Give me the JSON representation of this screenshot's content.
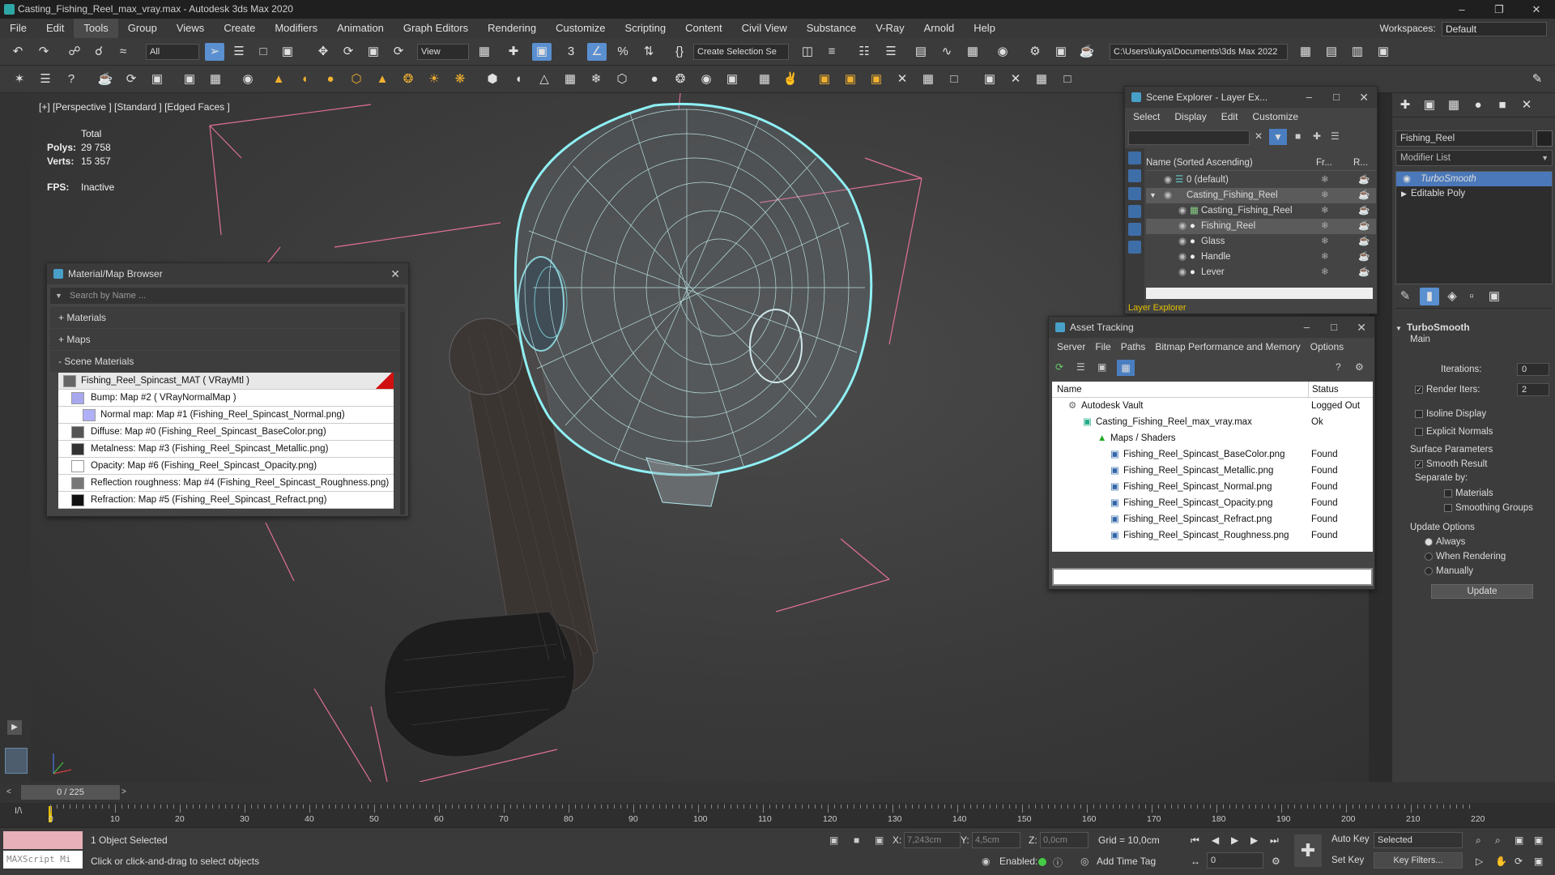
{
  "title": "Casting_Fishing_Reel_max_vray.max - Autodesk 3ds Max 2020",
  "menu": [
    "File",
    "Edit",
    "Tools",
    "Group",
    "Views",
    "Create",
    "Modifiers",
    "Animation",
    "Graph Editors",
    "Rendering",
    "Customize",
    "Scripting",
    "Content",
    "Civil View",
    "Substance",
    "V-Ray",
    "Arnold",
    "Help"
  ],
  "workspace": {
    "label": "Workspaces:",
    "value": "Default"
  },
  "toolbar": {
    "filter": "All",
    "refcoord": "View",
    "selection_set": "Create Selection Se",
    "project_path": "C:\\Users\\lukya\\Documents\\3ds Max 2022"
  },
  "viewport": {
    "label": "[+] [Perspective ] [Standard ] [Edged Faces ]",
    "stats_header": "Total",
    "polys_label": "Polys:",
    "polys": "29 758",
    "verts_label": "Verts:",
    "verts": "15 357",
    "fps_label": "FPS:",
    "fps": "Inactive"
  },
  "material_browser": {
    "title": "Material/Map Browser",
    "search_placeholder": "Search by Name ...",
    "sections": [
      "+ Materials",
      "+ Maps",
      "- Scene Materials"
    ],
    "material": "Fishing_Reel_Spincast_MAT  ( VRayMtl )",
    "maps": [
      "Bump: Map #2  ( VRayNormalMap )",
      "Normal map: Map #1 (Fishing_Reel_Spincast_Normal.png)",
      "Diffuse: Map #0 (Fishing_Reel_Spincast_BaseColor.png)",
      "Metalness: Map #3 (Fishing_Reel_Spincast_Metallic.png)",
      "Opacity: Map #6 (Fishing_Reel_Spincast_Opacity.png)",
      "Reflection roughness: Map #4 (Fishing_Reel_Spincast_Roughness.png)",
      "Refraction: Map #5 (Fishing_Reel_Spincast_Refract.png)"
    ]
  },
  "scene_explorer": {
    "title": "Scene Explorer - Layer Ex...",
    "menu": [
      "Select",
      "Display",
      "Edit",
      "Customize"
    ],
    "columns": [
      "Name (Sorted Ascending)",
      "Fr...",
      "R..."
    ],
    "rows": [
      "0 (default)",
      "Casting_Fishing_Reel",
      "Casting_Fishing_Reel",
      "Fishing_Reel",
      "Glass",
      "Handle",
      "Lever"
    ],
    "footer": "Layer Explorer"
  },
  "asset_tracking": {
    "title": "Asset Tracking",
    "menu": [
      "Server",
      "File",
      "Paths",
      "Bitmap Performance and Memory",
      "Options"
    ],
    "columns": [
      "Name",
      "Status"
    ],
    "rows": [
      {
        "name": "Autodesk Vault",
        "status": "Logged Out"
      },
      {
        "name": "Casting_Fishing_Reel_max_vray.max",
        "status": "Ok"
      },
      {
        "name": "Maps / Shaders",
        "status": ""
      },
      {
        "name": "Fishing_Reel_Spincast_BaseColor.png",
        "status": "Found"
      },
      {
        "name": "Fishing_Reel_Spincast_Metallic.png",
        "status": "Found"
      },
      {
        "name": "Fishing_Reel_Spincast_Normal.png",
        "status": "Found"
      },
      {
        "name": "Fishing_Reel_Spincast_Opacity.png",
        "status": "Found"
      },
      {
        "name": "Fishing_Reel_Spincast_Refract.png",
        "status": "Found"
      },
      {
        "name": "Fishing_Reel_Spincast_Roughness.png",
        "status": "Found"
      }
    ]
  },
  "command_panel": {
    "object_name": "Fishing_Reel",
    "modifier_list": "Modifier List",
    "stack": [
      "TurboSmooth",
      "Editable Poly"
    ],
    "rollout": "TurboSmooth",
    "main": "Main",
    "iterations_label": "Iterations:",
    "iterations": "0",
    "render_iters_label": "Render Iters:",
    "render_iters": "2",
    "isoline": "Isoline Display",
    "explicit_normals": "Explicit Normals",
    "surface_params": "Surface Parameters",
    "smooth_result": "Smooth Result",
    "separate_by": "Separate by:",
    "materials": "Materials",
    "smoothing_groups": "Smoothing Groups",
    "update_options": "Update Options",
    "always": "Always",
    "when_rendering": "When Rendering",
    "manually": "Manually",
    "update_button": "Update"
  },
  "timeline": {
    "frame": "0 / 225",
    "ticks": [
      "0",
      "10",
      "20",
      "30",
      "40",
      "50",
      "60",
      "70",
      "80",
      "90",
      "100",
      "110",
      "120",
      "130",
      "140",
      "150",
      "160",
      "170",
      "180",
      "190",
      "200",
      "210",
      "220"
    ]
  },
  "status": {
    "maxscript": "MAXScript Mi",
    "selected": "1 Object Selected",
    "prompt": "Click or click-and-drag to select objects",
    "x_label": "X:",
    "x": "7,243cm",
    "y_label": "Y:",
    "y": "4,5cm",
    "z_label": "Z:",
    "z": "0,0cm",
    "grid": "Grid = 10,0cm",
    "enabled": "Enabled:",
    "add_time_tag": "Add Time Tag",
    "auto_key": "Auto Key",
    "set_key": "Set Key",
    "key_mode": "Selected",
    "key_filters": "Key Filters...",
    "frame_field": "0"
  }
}
